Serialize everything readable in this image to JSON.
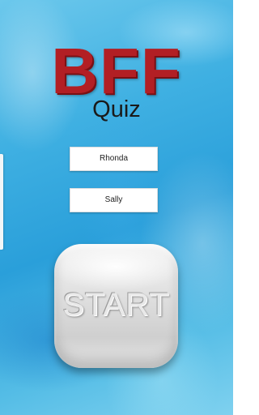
{
  "app": {
    "title": "BFF",
    "subtitle": "Quiz"
  },
  "names": {
    "first": "Rhonda",
    "second": "Sally"
  },
  "start_button": {
    "label": "START"
  },
  "colors": {
    "title_red": "#b21f24",
    "background_blue": "#2a9fda",
    "button_gray": "#dedede"
  }
}
